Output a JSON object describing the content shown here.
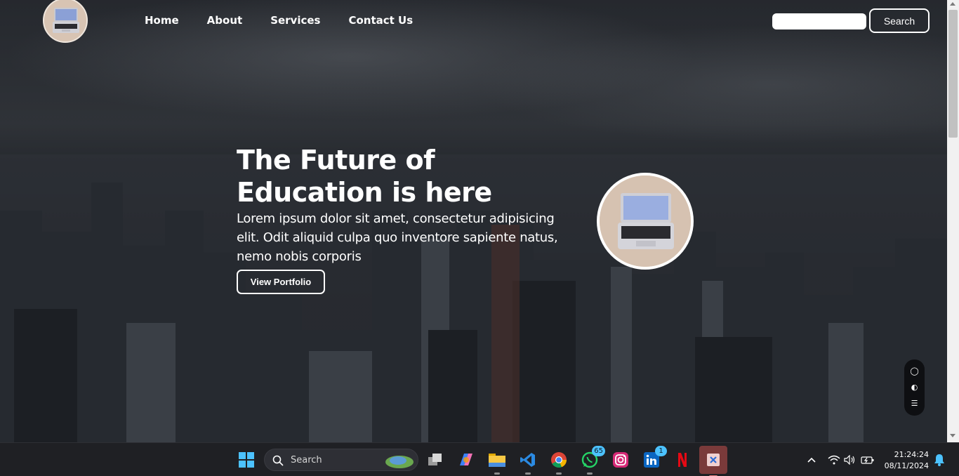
{
  "nav": {
    "items": [
      {
        "label": "Home"
      },
      {
        "label": "About"
      },
      {
        "label": "Services"
      },
      {
        "label": "Contact Us"
      }
    ],
    "search_placeholder": "",
    "search_button": "Search"
  },
  "hero": {
    "title": "The Future of Education is here",
    "text": "Lorem ipsum dolor sit amet, consectetur adipisicing elit. Odit aliquid culpa quo inventore sapiente natus, nemo nobis corporis",
    "button": "View Portfolio"
  },
  "taskbar": {
    "search_label": "Search",
    "whatsapp_badge": "65",
    "linkedin_badge": "1",
    "time": "21:24:24",
    "date": "08/11/2024"
  },
  "colors": {
    "accent": "#ffffff",
    "taskbar": "#1f2024",
    "badge": "#4cc2ff"
  }
}
